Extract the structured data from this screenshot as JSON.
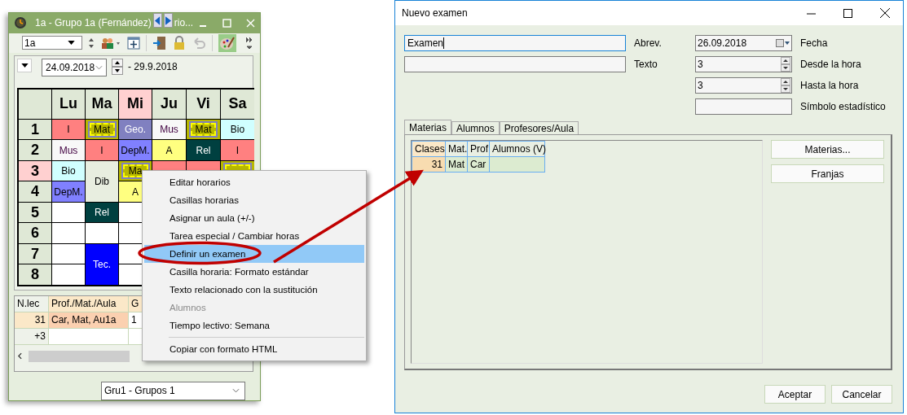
{
  "timetable_window": {
    "title": "1a - Grupo 1a (Fernández)",
    "title_tail": "rio...",
    "class_select": {
      "value": "1a"
    },
    "date_from": "24.09.2018",
    "date_to": "- 29.9.2018",
    "days": [
      {
        "label": "Lu",
        "highlighted": false
      },
      {
        "label": "Ma",
        "highlighted": false
      },
      {
        "label": "Mi",
        "highlighted": true
      },
      {
        "label": "Ju",
        "highlighted": false
      },
      {
        "label": "Vi",
        "highlighted": false
      },
      {
        "label": "Sa",
        "highlighted": false
      }
    ],
    "rows": [
      {
        "label": "1",
        "highlighted": false,
        "cells": [
          {
            "text": "I",
            "color": "#ff8080"
          },
          {
            "text": "Mat",
            "color": "#b8b800",
            "marked": true
          },
          {
            "text": "Geo.",
            "color": "#8080c0",
            "light_text": true
          },
          {
            "text": "Mus",
            "color": "#f8f8f8",
            "tinted_text": true
          },
          {
            "text": "Mat",
            "color": "#b8b800",
            "marked": true
          },
          {
            "text": "Bio",
            "color": "#d0ffff"
          }
        ]
      },
      {
        "label": "2",
        "highlighted": false,
        "cells": [
          {
            "text": "Mus",
            "color": "#f8f8f8",
            "tinted_text": true
          },
          {
            "text": "I",
            "color": "#ff8080"
          },
          {
            "text": "DepM.",
            "color": "#8080ff"
          },
          {
            "text": "A",
            "color": "#ffff80"
          },
          {
            "text": "Rel",
            "color": "#004040",
            "light_text": true
          },
          {
            "text": "I",
            "color": "#ff8080"
          }
        ]
      },
      {
        "label": "3",
        "highlighted": true,
        "cells": [
          {
            "text": "Bio",
            "color": "#d0ffff"
          },
          {
            "text": "Dib",
            "color": "#e8eee0"
          },
          {
            "text": "Ma",
            "color": "#b8b800",
            "marked": true
          },
          {
            "color": "#ff8080"
          },
          {
            "color": "#ff8080"
          },
          {
            "color": "#b8b800",
            "marked": true
          }
        ]
      },
      {
        "label": "4",
        "highlighted": false,
        "cells": [
          {
            "text": "DepM.",
            "color": "#8080ff"
          },
          {
            "merged": true
          },
          {
            "text": "A",
            "color": "#ffff80"
          }
        ]
      },
      {
        "label": "5",
        "highlighted": false,
        "cells": [
          {},
          {
            "text": "Rel",
            "color": "#004040",
            "light_text": true
          },
          {}
        ]
      },
      {
        "label": "6",
        "highlighted": false,
        "cells": [
          {},
          {},
          {}
        ]
      },
      {
        "label": "7",
        "highlighted": false,
        "cells": [
          {},
          {
            "text": "Tec.",
            "color": "#0000ff",
            "light_text": true
          },
          {}
        ]
      },
      {
        "label": "8",
        "highlighted": false,
        "cells": [
          {},
          {
            "merged": true
          },
          {}
        ]
      }
    ],
    "lessons": {
      "columns": [
        "N.lec",
        "Prof./Mat./Aula",
        "G"
      ],
      "rows": [
        {
          "selected": true,
          "cells": [
            "31",
            "Car, Mat, Au1a",
            "1"
          ]
        },
        {
          "selected": false,
          "cells": [
            "+3"
          ]
        }
      ]
    },
    "group_select": {
      "value": "Gru1 - Grupos 1"
    }
  },
  "context_menu": {
    "items": [
      {
        "label": "Editar horarios",
        "selected": false,
        "disabled": false,
        "separator_before": false
      },
      {
        "label": "Casillas horarias",
        "selected": false,
        "disabled": false,
        "separator_before": false
      },
      {
        "label": "Asignar un aula (+/-)",
        "selected": false,
        "disabled": false,
        "separator_before": false
      },
      {
        "label": "Tarea especial / Cambiar horas",
        "selected": false,
        "disabled": false,
        "separator_before": false
      },
      {
        "label": "Definir un examen",
        "selected": true,
        "disabled": false,
        "separator_before": false
      },
      {
        "label": "Casilla horaria: Formato estándar",
        "selected": false,
        "disabled": false,
        "separator_before": false
      },
      {
        "label": "Texto relacionado con la sustitución",
        "selected": false,
        "disabled": false,
        "separator_before": false
      },
      {
        "label": "Alumnos",
        "selected": false,
        "disabled": true,
        "separator_before": false
      },
      {
        "label": "Tiempo lectivo: Semana",
        "selected": false,
        "disabled": false,
        "separator_before": false
      },
      {
        "label": "Copiar con formato HTML",
        "selected": false,
        "disabled": false,
        "separator_before": true
      }
    ]
  },
  "exam_dialog": {
    "title": "Nuevo examen",
    "name_field": {
      "value": "Examen",
      "label": "Abrev."
    },
    "text_field": {
      "label": "Texto"
    },
    "date_field": {
      "value": "26.09.2018",
      "label": "Fecha"
    },
    "from_field": {
      "value": "3",
      "label": "Desde la hora"
    },
    "to_field": {
      "value": "3",
      "label": "Hasta la hora"
    },
    "symbol_field": {
      "label": "Símbolo estadístico"
    },
    "tabs": [
      {
        "label": "Materias",
        "selected": true
      },
      {
        "label": "Alumnos",
        "selected": false
      },
      {
        "label": "Profesores/Aula",
        "selected": false
      }
    ],
    "table": {
      "columns": [
        "Clases",
        "Mat.",
        "Prof",
        "Alumnos (V)"
      ],
      "rows": [
        {
          "cells": [
            "31",
            "Mat",
            "Car"
          ]
        }
      ]
    },
    "side_buttons": [
      "Materias...",
      "Franjas"
    ],
    "buttons": [
      "Aceptar",
      "Cancelar"
    ]
  }
}
